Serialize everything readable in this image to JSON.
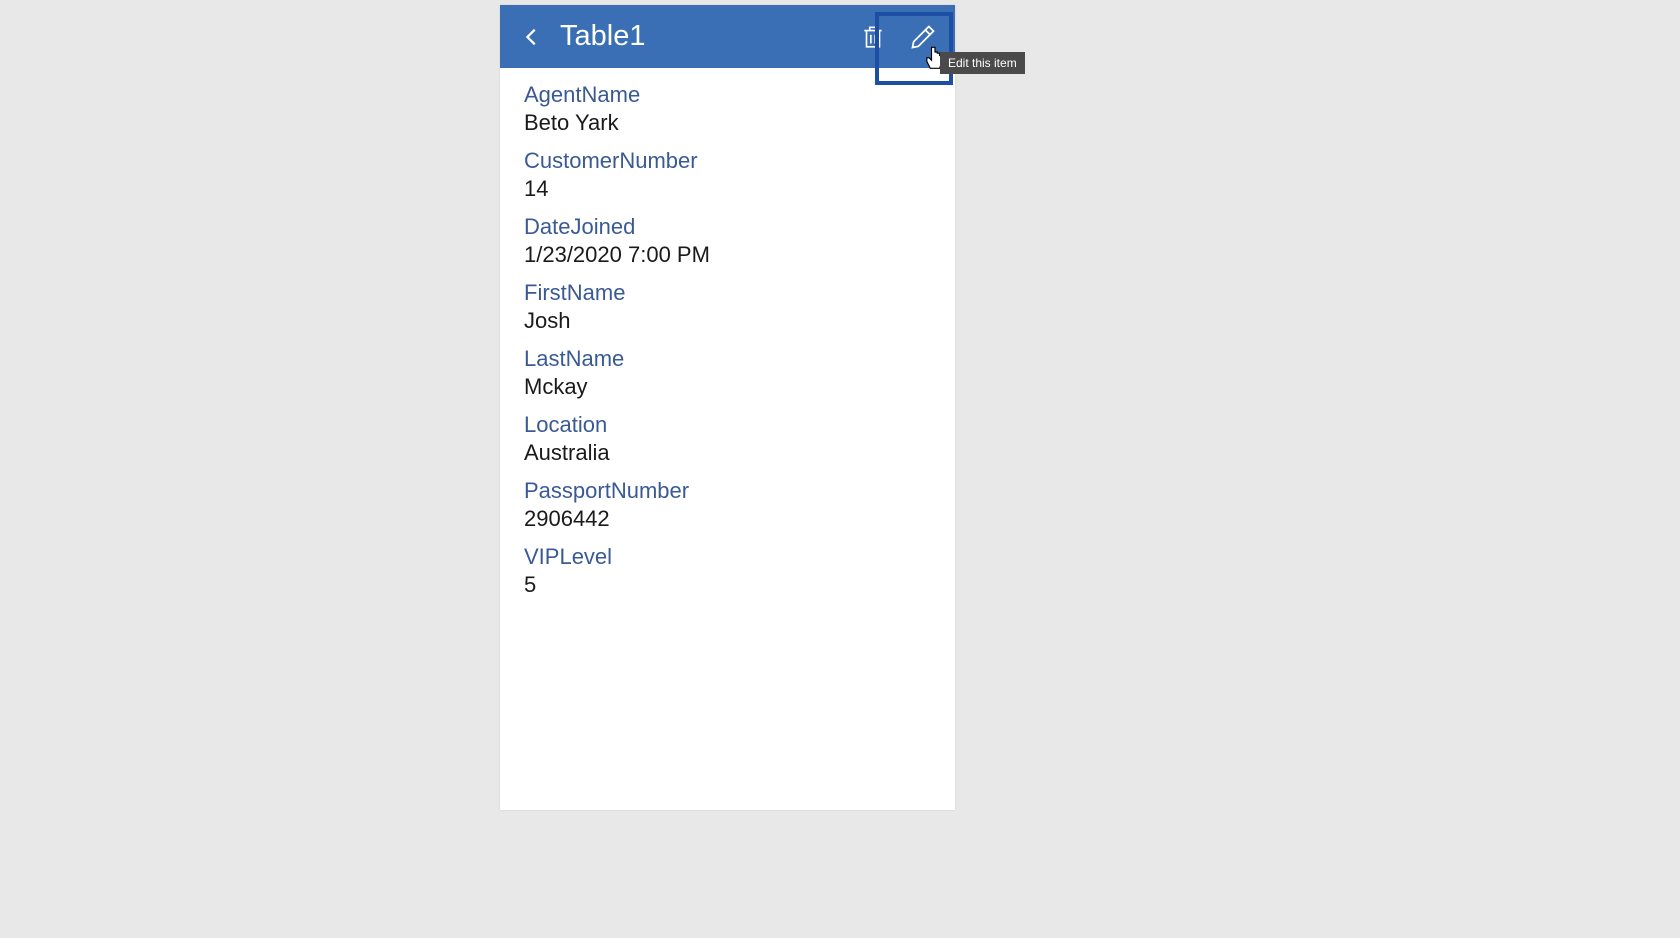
{
  "header": {
    "title": "Table1"
  },
  "tooltip": {
    "text": "Edit this item"
  },
  "fields": [
    {
      "label": "AgentName",
      "value": "Beto Yark"
    },
    {
      "label": "CustomerNumber",
      "value": "14"
    },
    {
      "label": "DateJoined",
      "value": "1/23/2020 7:00 PM"
    },
    {
      "label": "FirstName",
      "value": "Josh"
    },
    {
      "label": "LastName",
      "value": "Mckay"
    },
    {
      "label": "Location",
      "value": "Australia"
    },
    {
      "label": "PassportNumber",
      "value": "2906442"
    },
    {
      "label": "VIPLevel",
      "value": "5"
    }
  ]
}
